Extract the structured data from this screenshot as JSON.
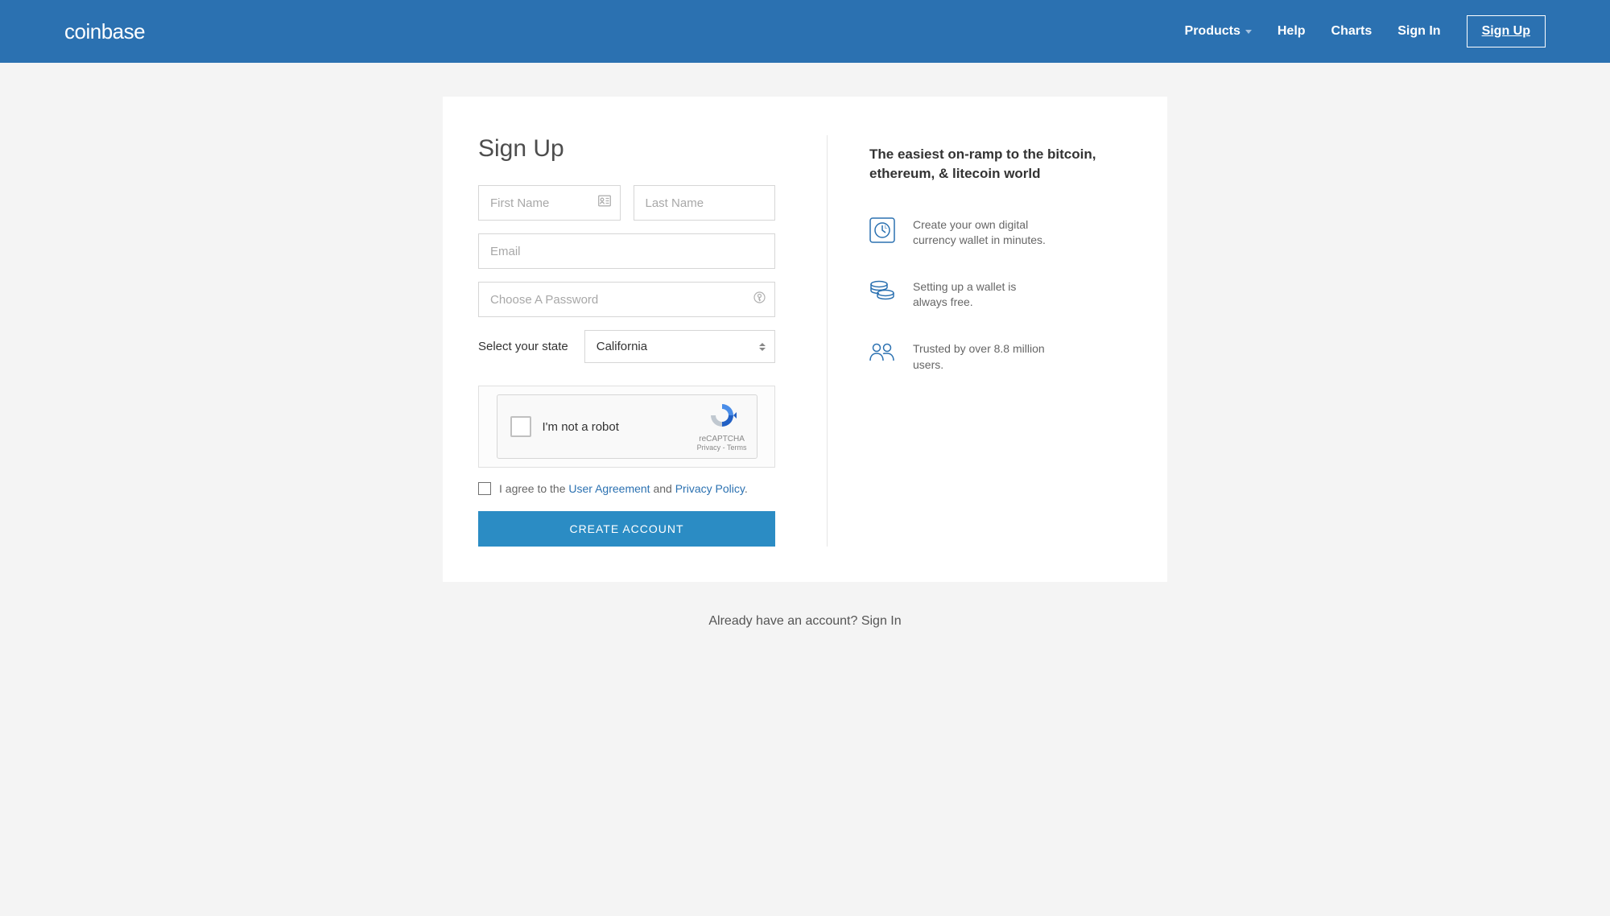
{
  "header": {
    "logo": "coinbase",
    "nav": {
      "products": "Products",
      "help": "Help",
      "charts": "Charts",
      "signin": "Sign In",
      "signup": "Sign Up"
    }
  },
  "form": {
    "title": "Sign Up",
    "first_name_placeholder": "First Name",
    "last_name_placeholder": "Last Name",
    "email_placeholder": "Email",
    "password_placeholder": "Choose A Password",
    "state_label": "Select your state",
    "state_value": "California",
    "captcha": {
      "label": "I'm not a robot",
      "brand": "reCAPTCHA",
      "links": "Privacy - Terms"
    },
    "agree": {
      "prefix": "I agree to the ",
      "ua": "User Agreement",
      "mid": " and ",
      "pp": "Privacy Policy",
      "suffix": "."
    },
    "submit": "CREATE ACCOUNT"
  },
  "info": {
    "title": "The easiest on-ramp to the bitcoin, ethereum, & litecoin world",
    "features": [
      "Create your own digital currency wallet in minutes.",
      "Setting up a wallet is always free.",
      "Trusted by over 8.8 million users."
    ]
  },
  "footer": {
    "prefix": "Already have an account? ",
    "link": "Sign In"
  }
}
